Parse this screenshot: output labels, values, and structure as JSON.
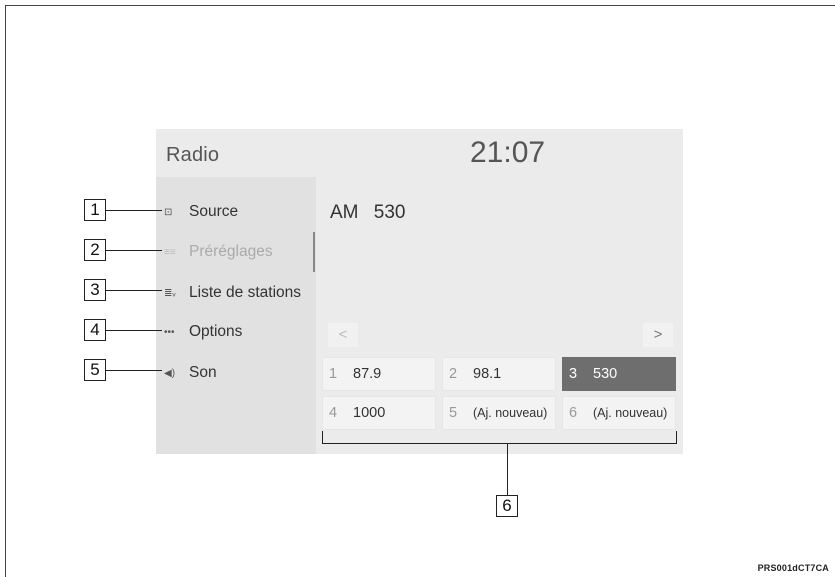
{
  "header": {
    "title": "Radio",
    "clock": "21:07"
  },
  "sidebar": {
    "items": [
      {
        "icon": "source-icon",
        "glyph": "⊡",
        "label": "Source"
      },
      {
        "icon": "presets-icon",
        "glyph": "≡≡",
        "label": "Préréglages"
      },
      {
        "icon": "station-list-icon",
        "glyph": "≣ᵥ",
        "label": "Liste de stations"
      },
      {
        "icon": "options-icon",
        "glyph": "•••",
        "label": "Options"
      },
      {
        "icon": "speaker-icon",
        "glyph": "◀)",
        "label": "Son"
      }
    ]
  },
  "main": {
    "band": "AM",
    "frequency": "530",
    "prev_arrow": "<",
    "next_arrow": ">",
    "presets": [
      {
        "num": "1",
        "value": "87.9"
      },
      {
        "num": "2",
        "value": "98.1"
      },
      {
        "num": "3",
        "value": "530"
      },
      {
        "num": "4",
        "value": "1000"
      },
      {
        "num": "5",
        "value": "(Aj. nouveau)"
      },
      {
        "num": "6",
        "value": "(Aj. nouveau)"
      }
    ],
    "active_preset": "3"
  },
  "callouts": [
    "1",
    "2",
    "3",
    "4",
    "5",
    "6"
  ],
  "figure_code": "PRS001dCT7CA"
}
